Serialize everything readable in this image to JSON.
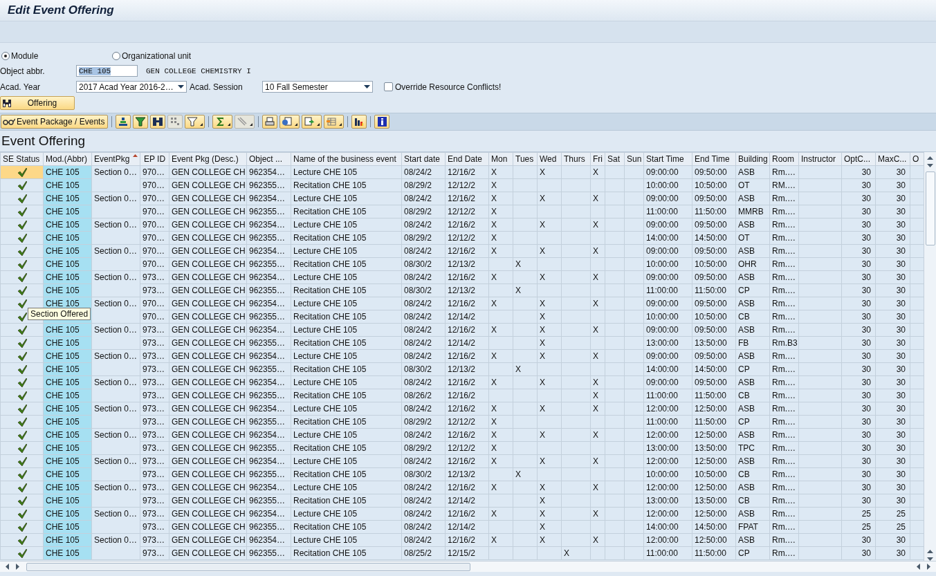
{
  "window": {
    "title": "Edit Event Offering"
  },
  "selection": [
    {
      "label": "Module",
      "selected": true
    },
    {
      "label": "Organizational unit",
      "selected": false
    }
  ],
  "object_abbr": {
    "label": "Object abbr.",
    "value": "CHE 105",
    "description": "GEN COLLEGE CHEMISTRY I"
  },
  "acad_year": {
    "label": "Acad. Year",
    "value": "2017 Acad Year 2016-2…"
  },
  "acad_session": {
    "label": "Acad. Session",
    "value": "10 Fall Semester"
  },
  "override": {
    "label": "Override Resource Conflicts!",
    "checked": false
  },
  "offering_button": "Offering",
  "package_button": "Event Package / Events",
  "table": {
    "title": "Event Offering",
    "columns": [
      {
        "label": "SE Status",
        "sorted": false
      },
      {
        "label": "Mod.(Abbr)",
        "sorted": false
      },
      {
        "label": "EventPkg",
        "sorted": true
      },
      {
        "label": "EP ID",
        "sorted": false
      },
      {
        "label": "Event Pkg (Desc.)",
        "sorted": false
      },
      {
        "label": "Object ...",
        "sorted": false
      },
      {
        "label": "Name of the business event",
        "sorted": false
      },
      {
        "label": "Start date",
        "sorted": false
      },
      {
        "label": "End Date",
        "sorted": false
      },
      {
        "label": "Mon",
        "sorted": false
      },
      {
        "label": "Tues",
        "sorted": false
      },
      {
        "label": "Wed",
        "sorted": false
      },
      {
        "label": "Thurs",
        "sorted": false
      },
      {
        "label": "Fri",
        "sorted": false
      },
      {
        "label": "Sat",
        "sorted": false
      },
      {
        "label": "Sun",
        "sorted": false
      },
      {
        "label": "Start Time",
        "sorted": false
      },
      {
        "label": "End Time",
        "sorted": false
      },
      {
        "label": "Building",
        "sorted": false
      },
      {
        "label": "Room",
        "sorted": false
      },
      {
        "label": "Instructor",
        "sorted": false
      },
      {
        "label": "OptC...",
        "sorted": false
      },
      {
        "label": "MaxC...",
        "sorted": false
      },
      {
        "label": "O",
        "sorted": false
      }
    ],
    "rows": [
      {
        "kind": "offered",
        "selected": true,
        "module": "CHE 105",
        "package": "Section 0…",
        "ep_id": "970…",
        "package_desc": "GEN COLLEGE CH",
        "object": "962354…",
        "name": "Lecture CHE 105",
        "start_date": "08/24/2",
        "end_date": "12/16/2",
        "mon": "X",
        "wed": "X",
        "fri": "X",
        "start_time": "09:00:00",
        "end_time": "09:50:00",
        "building": "ASB",
        "room": "Rm.…",
        "opt_cap": "30",
        "max_cap": "30"
      },
      {
        "kind": "offered",
        "selected": false,
        "module": "CHE 105",
        "ep_id": "970…",
        "package_desc": "GEN COLLEGE CH",
        "object": "962355…",
        "name": "Recitation CHE 105",
        "start_date": "08/29/2",
        "end_date": "12/12/2",
        "mon": "X",
        "start_time": "10:00:00",
        "end_time": "10:50:00",
        "building": "OT",
        "room": "RM.…",
        "opt_cap": "30",
        "max_cap": "30"
      },
      {
        "kind": "offered",
        "selected": false,
        "module": "CHE 105",
        "package": "Section 0…",
        "ep_id": "970…",
        "package_desc": "GEN COLLEGE CH",
        "object": "962354…",
        "name": "Lecture CHE 105",
        "start_date": "08/24/2",
        "end_date": "12/16/2",
        "mon": "X",
        "wed": "X",
        "fri": "X",
        "start_time": "09:00:00",
        "end_time": "09:50:00",
        "building": "ASB",
        "room": "Rm.…",
        "opt_cap": "30",
        "max_cap": "30"
      },
      {
        "kind": "offered",
        "selected": false,
        "module": "CHE 105",
        "ep_id": "970…",
        "package_desc": "GEN COLLEGE CH",
        "object": "962355…",
        "name": "Recitation CHE 105",
        "start_date": "08/29/2",
        "end_date": "12/12/2",
        "mon": "X",
        "start_time": "11:00:00",
        "end_time": "11:50:00",
        "building": "MMRB",
        "room": "Rm.…",
        "opt_cap": "30",
        "max_cap": "30"
      },
      {
        "kind": "offered",
        "selected": false,
        "module": "CHE 105",
        "package": "Section 0…",
        "ep_id": "970…",
        "package_desc": "GEN COLLEGE CH",
        "object": "962354…",
        "name": "Lecture CHE 105",
        "start_date": "08/24/2",
        "end_date": "12/16/2",
        "mon": "X",
        "wed": "X",
        "fri": "X",
        "start_time": "09:00:00",
        "end_time": "09:50:00",
        "building": "ASB",
        "room": "Rm.…",
        "opt_cap": "30",
        "max_cap": "30"
      },
      {
        "kind": "offered",
        "selected": false,
        "module": "CHE 105",
        "ep_id": "970…",
        "package_desc": "GEN COLLEGE CH",
        "object": "962355…",
        "name": "Recitation CHE 105",
        "start_date": "08/29/2",
        "end_date": "12/12/2",
        "mon": "X",
        "start_time": "14:00:00",
        "end_time": "14:50:00",
        "building": "OT",
        "room": "Rm.…",
        "opt_cap": "30",
        "max_cap": "30"
      },
      {
        "kind": "offered",
        "selected": false,
        "module": "CHE 105",
        "package": "Section 0…",
        "ep_id": "970…",
        "package_desc": "GEN COLLEGE CH",
        "object": "962354…",
        "name": "Lecture CHE 105",
        "start_date": "08/24/2",
        "end_date": "12/16/2",
        "mon": "X",
        "wed": "X",
        "fri": "X",
        "start_time": "09:00:00",
        "end_time": "09:50:00",
        "building": "ASB",
        "room": "Rm.…",
        "opt_cap": "30",
        "max_cap": "30"
      },
      {
        "kind": "offered",
        "selected": false,
        "module": "CHE 105",
        "ep_id": "970…",
        "package_desc": "GEN COLLEGE CH",
        "object": "962355…",
        "name": "Recitation CHE 105",
        "start_date": "08/30/2",
        "end_date": "12/13/2",
        "tues": "X",
        "start_time": "10:00:00",
        "end_time": "10:50:00",
        "building": "OHR",
        "room": "Rm.…",
        "opt_cap": "30",
        "max_cap": "30"
      },
      {
        "kind": "offered",
        "selected": false,
        "module": "CHE 105",
        "package": "Section 0…",
        "ep_id": "973…",
        "package_desc": "GEN COLLEGE CH",
        "object": "962354…",
        "name": "Lecture CHE 105",
        "start_date": "08/24/2",
        "end_date": "12/16/2",
        "mon": "X",
        "wed": "X",
        "fri": "X",
        "start_time": "09:00:00",
        "end_time": "09:50:00",
        "building": "ASB",
        "room": "Rm.…",
        "opt_cap": "30",
        "max_cap": "30"
      },
      {
        "kind": "offered",
        "selected": false,
        "module": "CHE 105",
        "ep_id": "973…",
        "package_desc": "GEN COLLEGE CH",
        "object": "962355…",
        "name": "Recitation CHE 105",
        "start_date": "08/30/2",
        "end_date": "12/13/2",
        "tues": "X",
        "start_time": "11:00:00",
        "end_time": "11:50:00",
        "building": "CP",
        "room": "Rm.…",
        "opt_cap": "30",
        "max_cap": "30"
      },
      {
        "kind": "offered",
        "selected": false,
        "module": "CHE 105",
        "package": "Section 0…",
        "ep_id": "970…",
        "package_desc": "GEN COLLEGE CH",
        "object": "962354…",
        "name": "Lecture CHE 105",
        "start_date": "08/24/2",
        "end_date": "12/16/2",
        "mon": "X",
        "wed": "X",
        "fri": "X",
        "start_time": "09:00:00",
        "end_time": "09:50:00",
        "building": "ASB",
        "room": "Rm.…",
        "opt_cap": "30",
        "max_cap": "30"
      },
      {
        "kind": "offered",
        "selected": false,
        "ep_id": "970…",
        "package_desc": "GEN COLLEGE CH",
        "object": "962355…",
        "name": "Recitation CHE 105",
        "start_date": "08/24/2",
        "end_date": "12/14/2",
        "wed": "X",
        "start_time": "10:00:00",
        "end_time": "10:50:00",
        "building": "CB",
        "room": "Rm.…",
        "opt_cap": "30",
        "max_cap": "30"
      },
      {
        "kind": "offered",
        "selected": false,
        "module": "CHE 105",
        "package": "Section 0…",
        "ep_id": "973…",
        "package_desc": "GEN COLLEGE CH",
        "object": "962354…",
        "name": "Lecture CHE 105",
        "start_date": "08/24/2",
        "end_date": "12/16/2",
        "mon": "X",
        "wed": "X",
        "fri": "X",
        "start_time": "09:00:00",
        "end_time": "09:50:00",
        "building": "ASB",
        "room": "Rm.…",
        "opt_cap": "30",
        "max_cap": "30"
      },
      {
        "kind": "offered",
        "selected": false,
        "module": "CHE 105",
        "ep_id": "973…",
        "package_desc": "GEN COLLEGE CH",
        "object": "962355…",
        "name": "Recitation CHE 105",
        "start_date": "08/24/2",
        "end_date": "12/14/2",
        "wed": "X",
        "start_time": "13:00:00",
        "end_time": "13:50:00",
        "building": "FB",
        "room": "Rm.B3",
        "opt_cap": "30",
        "max_cap": "30"
      },
      {
        "kind": "offered",
        "selected": false,
        "module": "CHE 105",
        "package": "Section 0…",
        "ep_id": "973…",
        "package_desc": "GEN COLLEGE CH",
        "object": "962354…",
        "name": "Lecture CHE 105",
        "start_date": "08/24/2",
        "end_date": "12/16/2",
        "mon": "X",
        "wed": "X",
        "fri": "X",
        "start_time": "09:00:00",
        "end_time": "09:50:00",
        "building": "ASB",
        "room": "Rm.…",
        "opt_cap": "30",
        "max_cap": "30"
      },
      {
        "kind": "offered",
        "selected": false,
        "module": "CHE 105",
        "ep_id": "973…",
        "package_desc": "GEN COLLEGE CH",
        "object": "962355…",
        "name": "Recitation CHE 105",
        "start_date": "08/30/2",
        "end_date": "12/13/2",
        "tues": "X",
        "start_time": "14:00:00",
        "end_time": "14:50:00",
        "building": "CP",
        "room": "Rm.…",
        "opt_cap": "30",
        "max_cap": "30"
      },
      {
        "kind": "offered",
        "selected": false,
        "module": "CHE 105",
        "package": "Section 0…",
        "ep_id": "973…",
        "package_desc": "GEN COLLEGE CH",
        "object": "962354…",
        "name": "Lecture CHE 105",
        "start_date": "08/24/2",
        "end_date": "12/16/2",
        "mon": "X",
        "wed": "X",
        "fri": "X",
        "start_time": "09:00:00",
        "end_time": "09:50:00",
        "building": "ASB",
        "room": "Rm.…",
        "opt_cap": "30",
        "max_cap": "30"
      },
      {
        "kind": "offered",
        "selected": false,
        "module": "CHE 105",
        "ep_id": "973…",
        "package_desc": "GEN COLLEGE CH",
        "object": "962355…",
        "name": "Recitation CHE 105",
        "start_date": "08/26/2",
        "end_date": "12/16/2",
        "fri": "X",
        "start_time": "11:00:00",
        "end_time": "11:50:00",
        "building": "CB",
        "room": "Rm.…",
        "opt_cap": "30",
        "max_cap": "30"
      },
      {
        "kind": "offered",
        "selected": false,
        "module": "CHE 105",
        "package": "Section 0…",
        "ep_id": "973…",
        "package_desc": "GEN COLLEGE CH",
        "object": "962354…",
        "name": "Lecture CHE 105",
        "start_date": "08/24/2",
        "end_date": "12/16/2",
        "mon": "X",
        "wed": "X",
        "fri": "X",
        "start_time": "12:00:00",
        "end_time": "12:50:00",
        "building": "ASB",
        "room": "Rm.…",
        "opt_cap": "30",
        "max_cap": "30"
      },
      {
        "kind": "offered",
        "selected": false,
        "module": "CHE 105",
        "ep_id": "973…",
        "package_desc": "GEN COLLEGE CH",
        "object": "962355…",
        "name": "Recitation CHE 105",
        "start_date": "08/29/2",
        "end_date": "12/12/2",
        "mon": "X",
        "start_time": "11:00:00",
        "end_time": "11:50:00",
        "building": "CP",
        "room": "Rm.…",
        "opt_cap": "30",
        "max_cap": "30"
      },
      {
        "kind": "offered",
        "selected": false,
        "module": "CHE 105",
        "package": "Section 0…",
        "ep_id": "973…",
        "package_desc": "GEN COLLEGE CH",
        "object": "962354…",
        "name": "Lecture CHE 105",
        "start_date": "08/24/2",
        "end_date": "12/16/2",
        "mon": "X",
        "wed": "X",
        "fri": "X",
        "start_time": "12:00:00",
        "end_time": "12:50:00",
        "building": "ASB",
        "room": "Rm.…",
        "opt_cap": "30",
        "max_cap": "30"
      },
      {
        "kind": "offered",
        "selected": false,
        "module": "CHE 105",
        "ep_id": "973…",
        "package_desc": "GEN COLLEGE CH",
        "object": "962355…",
        "name": "Recitation CHE 105",
        "start_date": "08/29/2",
        "end_date": "12/12/2",
        "mon": "X",
        "start_time": "13:00:00",
        "end_time": "13:50:00",
        "building": "TPC",
        "room": "Rm.…",
        "opt_cap": "30",
        "max_cap": "30"
      },
      {
        "kind": "offered",
        "selected": false,
        "module": "CHE 105",
        "package": "Section 0…",
        "ep_id": "973…",
        "package_desc": "GEN COLLEGE CH",
        "object": "962354…",
        "name": "Lecture CHE 105",
        "start_date": "08/24/2",
        "end_date": "12/16/2",
        "mon": "X",
        "wed": "X",
        "fri": "X",
        "start_time": "12:00:00",
        "end_time": "12:50:00",
        "building": "ASB",
        "room": "Rm.…",
        "opt_cap": "30",
        "max_cap": "30"
      },
      {
        "kind": "offered",
        "selected": false,
        "module": "CHE 105",
        "ep_id": "973…",
        "package_desc": "GEN COLLEGE CH",
        "object": "962355…",
        "name": "Recitation CHE 105",
        "start_date": "08/30/2",
        "end_date": "12/13/2",
        "tues": "X",
        "start_time": "10:00:00",
        "end_time": "10:50:00",
        "building": "CB",
        "room": "Rm.…",
        "opt_cap": "30",
        "max_cap": "30"
      },
      {
        "kind": "offered",
        "selected": false,
        "module": "CHE 105",
        "package": "Section 0…",
        "ep_id": "973…",
        "package_desc": "GEN COLLEGE CH",
        "object": "962354…",
        "name": "Lecture CHE 105",
        "start_date": "08/24/2",
        "end_date": "12/16/2",
        "mon": "X",
        "wed": "X",
        "fri": "X",
        "start_time": "12:00:00",
        "end_time": "12:50:00",
        "building": "ASB",
        "room": "Rm.…",
        "opt_cap": "30",
        "max_cap": "30"
      },
      {
        "kind": "offered",
        "selected": false,
        "module": "CHE 105",
        "ep_id": "973…",
        "package_desc": "GEN COLLEGE CH",
        "object": "962355…",
        "name": "Recitation CHE 105",
        "start_date": "08/24/2",
        "end_date": "12/14/2",
        "wed": "X",
        "start_time": "13:00:00",
        "end_time": "13:50:00",
        "building": "CB",
        "room": "Rm.…",
        "opt_cap": "30",
        "max_cap": "30"
      },
      {
        "kind": "offered",
        "selected": false,
        "module": "CHE 105",
        "package": "Section 0…",
        "ep_id": "973…",
        "package_desc": "GEN COLLEGE CH",
        "object": "962354…",
        "name": "Lecture CHE 105",
        "start_date": "08/24/2",
        "end_date": "12/16/2",
        "mon": "X",
        "wed": "X",
        "fri": "X",
        "start_time": "12:00:00",
        "end_time": "12:50:00",
        "building": "ASB",
        "room": "Rm.…",
        "opt_cap": "25",
        "max_cap": "25"
      },
      {
        "kind": "offered",
        "selected": false,
        "module": "CHE 105",
        "ep_id": "973…",
        "package_desc": "GEN COLLEGE CH",
        "object": "962355…",
        "name": "Recitation CHE 105",
        "start_date": "08/24/2",
        "end_date": "12/14/2",
        "wed": "X",
        "start_time": "14:00:00",
        "end_time": "14:50:00",
        "building": "FPAT",
        "room": "Rm.…",
        "opt_cap": "25",
        "max_cap": "25"
      },
      {
        "kind": "offered",
        "selected": false,
        "module": "CHE 105",
        "package": "Section 0…",
        "ep_id": "973…",
        "package_desc": "GEN COLLEGE CH",
        "object": "962354…",
        "name": "Lecture CHE 105",
        "start_date": "08/24/2",
        "end_date": "12/16/2",
        "mon": "X",
        "wed": "X",
        "fri": "X",
        "start_time": "12:00:00",
        "end_time": "12:50:00",
        "building": "ASB",
        "room": "Rm.…",
        "opt_cap": "30",
        "max_cap": "30"
      },
      {
        "kind": "offered",
        "selected": false,
        "module": "CHE 105",
        "ep_id": "973…",
        "package_desc": "GEN COLLEGE CH",
        "object": "962355…",
        "name": "Recitation CHE 105",
        "start_date": "08/25/2",
        "end_date": "12/15/2",
        "thurs": "X",
        "start_time": "11:00:00",
        "end_time": "11:50:00",
        "building": "CP",
        "room": "Rm.…",
        "opt_cap": "30",
        "max_cap": "30"
      }
    ]
  },
  "tooltip": "Section Offered"
}
